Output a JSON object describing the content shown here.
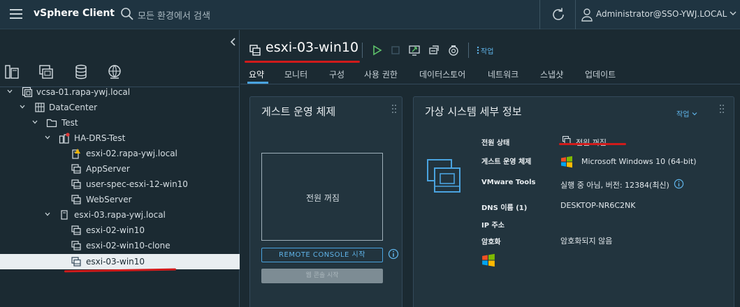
{
  "header": {
    "app_title": "vSphere Client",
    "search_placeholder": "모든 환경에서 검색",
    "user": "Administrator@SSO-YWJ.LOCAL"
  },
  "inventory_tabs": [
    {
      "icon": "hosts-clusters-icon",
      "active": true
    },
    {
      "icon": "vms-templates-icon",
      "active": false
    },
    {
      "icon": "storage-icon",
      "active": false
    },
    {
      "icon": "networking-icon",
      "active": false
    }
  ],
  "tree": [
    {
      "label": "vcsa-01.rapa-ywj.local",
      "icon": "vcenter-icon",
      "expanded": true
    },
    {
      "label": "DataCenter",
      "icon": "datacenter-icon",
      "expanded": true
    },
    {
      "label": "Test",
      "icon": "folder-icon",
      "expanded": true
    },
    {
      "label": "HA-DRS-Test",
      "icon": "cluster-icon",
      "expanded": true
    },
    {
      "label": "esxi-02.rapa-ywj.local",
      "icon": "host-warning-icon"
    },
    {
      "label": "AppServer",
      "icon": "vm-icon"
    },
    {
      "label": "user-spec-esxi-12-win10",
      "icon": "vm-icon"
    },
    {
      "label": "WebServer",
      "icon": "vm-icon"
    },
    {
      "label": "esxi-03.rapa-ywj.local",
      "icon": "host-icon",
      "expanded": true
    },
    {
      "label": "esxi-02-win10",
      "icon": "vm-icon"
    },
    {
      "label": "esxi-02-win10-clone",
      "icon": "vm-icon"
    },
    {
      "label": "esxi-03-win10",
      "icon": "vm-icon",
      "selected": true
    }
  ],
  "main": {
    "vm_name": "esxi-03-win10",
    "actions_label": "작업",
    "tabs": [
      "요약",
      "모니터",
      "구성",
      "사용 권한",
      "데이터스토어",
      "네트워크",
      "스냅샷",
      "업데이트"
    ],
    "active_tab": "요약"
  },
  "guest_os_card": {
    "title": "게스트 운영 체제",
    "console_text": "전원 꺼짐",
    "remote_console_button": "REMOTE CONSOLE 시작",
    "web_console_button": "웹 콘솔 시작"
  },
  "vm_details_card": {
    "title": "가상 시스템 세부 정보",
    "actions_link": "작업",
    "properties": [
      {
        "label": "전원 상태",
        "value": "전원 꺼짐"
      },
      {
        "label": "게스트 운영 체제",
        "value": "Microsoft Windows 10 (64-bit)"
      },
      {
        "label": "VMware Tools",
        "value": "실행 중 아님, 버전: 12384(최신)"
      },
      {
        "label": "DNS 이름 (1)",
        "value": "DESKTOP-NR6C2NK"
      },
      {
        "label": "IP 주소",
        "value": ""
      },
      {
        "label": "암호화",
        "value": "암호화되지 않음"
      }
    ]
  },
  "colors": {
    "accent": "#4aa3df",
    "power_on": "#5fc36b",
    "annotation": "#d01b1b",
    "header_bg": "#1f3441",
    "panel_bg": "#1b2a32",
    "card_bg": "#22343e"
  }
}
